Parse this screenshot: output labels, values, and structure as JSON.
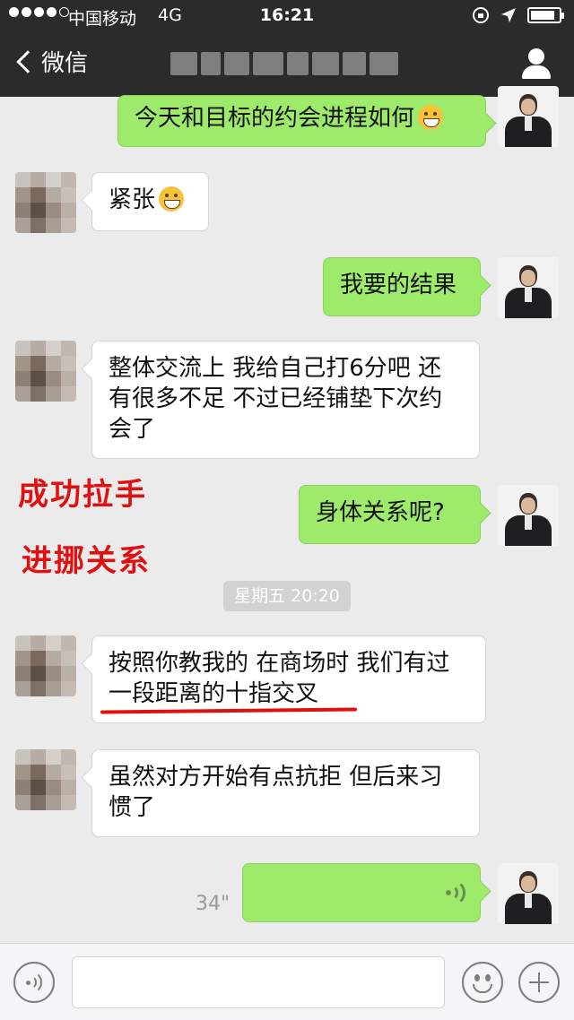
{
  "status_bar": {
    "carrier": "中国移动",
    "network": "4G",
    "time": "16:21",
    "battery_level": 0.85
  },
  "nav": {
    "back_label": "微信"
  },
  "messages": [
    {
      "side": "out",
      "text": "今天和目标的约会进程如何",
      "emoji": "grinning-face"
    },
    {
      "side": "in",
      "text": "紧张",
      "emoji": "tears-of-joy"
    },
    {
      "side": "out",
      "text": "我要的结果"
    },
    {
      "side": "in",
      "text": "整体交流上 我给自己打6分吧 还有很多不足 不过已经铺垫下次约会了"
    },
    {
      "side": "out",
      "text": "身体关系呢?"
    },
    {
      "side": "in",
      "text": "按照你教我的 在商场时 我们有过一段距离的十指交叉"
    },
    {
      "side": "in",
      "text": "虽然对方开始有点抗拒 但后来习惯了"
    },
    {
      "side": "out",
      "type": "voice",
      "duration": "34\""
    }
  ],
  "annotations": [
    "成功拉手",
    "进挪关系"
  ],
  "timestamp": "星期五 20:20",
  "colors": {
    "header": "#2b2b2b",
    "background": "#ebebeb",
    "outgoing_bubble": "#9eea6a",
    "incoming_bubble": "#ffffff",
    "annotation": "#e01010"
  },
  "icons": {
    "back": "chevron-left-icon",
    "profile": "person-icon",
    "voice_toggle": "voice-icon",
    "emoji": "smiley-icon",
    "more": "plus-icon"
  }
}
